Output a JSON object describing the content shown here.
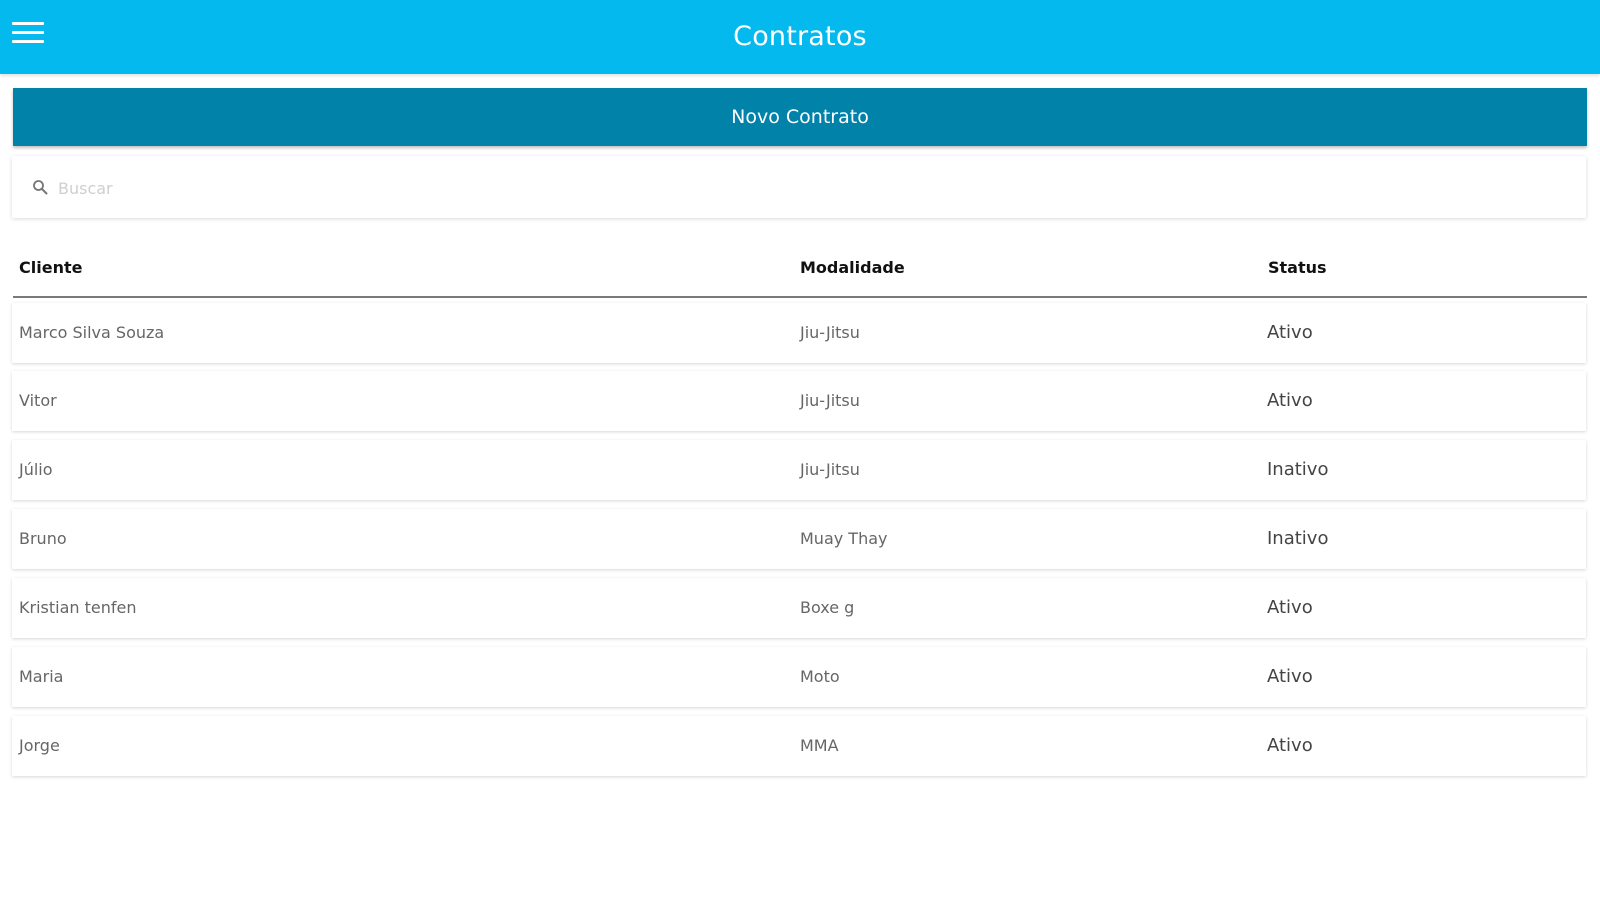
{
  "appbar": {
    "title": "Contratos",
    "color": "#03b9ee"
  },
  "actions": {
    "new_contract_label": "Novo Contrato",
    "button_color": "#0082a9"
  },
  "search": {
    "placeholder": "Buscar",
    "value": ""
  },
  "table": {
    "headers": {
      "client": "Cliente",
      "modality": "Modalidade",
      "status": "Status"
    },
    "rows": [
      {
        "client": "Marco Silva Souza",
        "modality": "Jiu-Jitsu",
        "status": "Ativo"
      },
      {
        "client": "Vitor",
        "modality": "Jiu-Jitsu",
        "status": "Ativo"
      },
      {
        "client": "Júlio",
        "modality": "Jiu-Jitsu",
        "status": "Inativo"
      },
      {
        "client": "Bruno",
        "modality": "Muay Thay",
        "status": "Inativo"
      },
      {
        "client": "Kristian tenfen",
        "modality": "Boxe g",
        "status": "Ativo"
      },
      {
        "client": "Maria",
        "modality": "Moto",
        "status": "Ativo"
      },
      {
        "client": "Jorge",
        "modality": "MMA",
        "status": "Ativo"
      }
    ]
  },
  "icons": {
    "menu": "hamburger-menu-icon",
    "search": "magnifier-icon"
  }
}
